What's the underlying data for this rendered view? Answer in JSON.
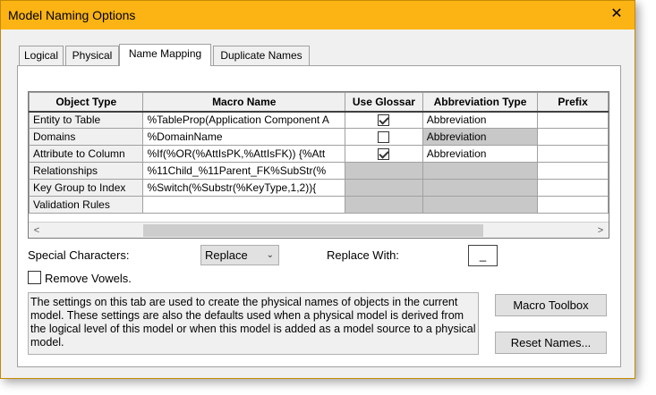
{
  "window": {
    "title": "Model Naming Options"
  },
  "tabs": [
    {
      "label": "Logical"
    },
    {
      "label": "Physical"
    },
    {
      "label": "Name Mapping"
    },
    {
      "label": "Duplicate Names"
    }
  ],
  "grid": {
    "headers": [
      "Object Type",
      "Macro Name",
      "Use Glossar",
      "Abbreviation Type",
      "Prefix"
    ],
    "rows": [
      {
        "object_type": "Entity to Table",
        "macro": "%TableProp(Application Component A",
        "glossary": true,
        "abbrev": "Abbreviation",
        "abbrev_disabled": false,
        "glossary_disabled": false
      },
      {
        "object_type": "Domains",
        "macro": "%DomainName",
        "glossary": false,
        "abbrev": "Abbreviation",
        "abbrev_disabled": true,
        "glossary_disabled": false
      },
      {
        "object_type": "Attribute to Column",
        "macro": "%If(%OR(%AttIsPK,%AttIsFK)) {%Att",
        "glossary": true,
        "abbrev": "Abbreviation",
        "abbrev_disabled": false,
        "glossary_disabled": false
      },
      {
        "object_type": "Relationships",
        "macro": "%11Child_%11Parent_FK%SubStr(%",
        "glossary": null,
        "abbrev": "",
        "abbrev_disabled": true,
        "glossary_disabled": true
      },
      {
        "object_type": "Key Group to Index",
        "macro": "%Switch(%Substr(%KeyType,1,2)){",
        "glossary": null,
        "abbrev": "",
        "abbrev_disabled": true,
        "glossary_disabled": true
      },
      {
        "object_type": "Validation Rules",
        "macro": "",
        "glossary": null,
        "abbrev": "",
        "abbrev_disabled": true,
        "glossary_disabled": true
      }
    ]
  },
  "special_characters": {
    "label": "Special Characters:",
    "value": "Replace"
  },
  "replace_with": {
    "label": "Replace With:",
    "value": "_"
  },
  "remove_vowels": {
    "label": "Remove Vowels.",
    "checked": false
  },
  "description": "The settings on this tab are used to create the physical names of objects in the current model. These settings are also the defaults used when a physical model is derived from the logical level of this model or when this model is added as a model source to a physical model.",
  "buttons": {
    "macro_toolbox": "Macro Toolbox",
    "reset_names": "Reset Names..."
  },
  "icons": {
    "close": "close-icon",
    "scroll_left": "arrow-left-icon",
    "scroll_right": "arrow-right-icon",
    "dropdown": "chevron-down-icon"
  }
}
